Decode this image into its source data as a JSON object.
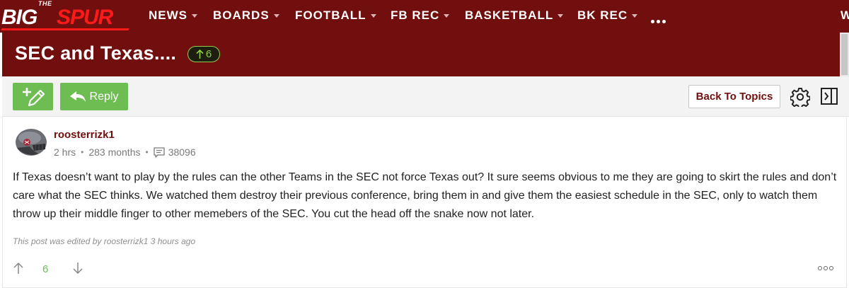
{
  "brand": {
    "the_text": "THE",
    "big_text": "BIG",
    "spur_text": "SPUR",
    "primary_color": "#710f0e",
    "accent_color": "#ff1a1a"
  },
  "nav": {
    "items": [
      {
        "label": "NEWS"
      },
      {
        "label": "BOARDS"
      },
      {
        "label": "FOOTBALL"
      },
      {
        "label": "FB REC"
      },
      {
        "label": "BASKETBALL"
      },
      {
        "label": "BK REC"
      }
    ],
    "more_icon": "ellipsis-icon",
    "edge_glyph": "W"
  },
  "topic": {
    "title": "SEC and Texas....",
    "upvotes": "6",
    "upvote_icon": "arrow-up-icon",
    "upvote_color": "#8fce4a"
  },
  "toolbar": {
    "new_topic_icon": "plus-pencil-icon",
    "reply_label": "Reply",
    "reply_icon": "reply-arrow-icon",
    "back_label": "Back To Topics",
    "settings_icon": "gear-icon",
    "panel_icon": "sidebar-toggle-icon",
    "button_color": "#6dbd52"
  },
  "post": {
    "author": "roosterrizk1",
    "time_ago": "2 hrs",
    "membership": "283 months",
    "post_count": "38096",
    "body": "If Texas doesn’t want to play by the rules can the other Teams in the SEC not force Texas out? It sure seems obvious to me they are going to skirt the rules and don’t care what the SEC thinks. We watched them destroy their previous conference, bring them in and give them the easiest schedule in the SEC, only to watch them throw up their middle finger to other memebers of the SEC. You cut the head off the snake now not later.",
    "edited_note": "This post was edited by roosterrizk1 3 hours ago",
    "votes": "6",
    "vote_color": "#6dbd52"
  }
}
